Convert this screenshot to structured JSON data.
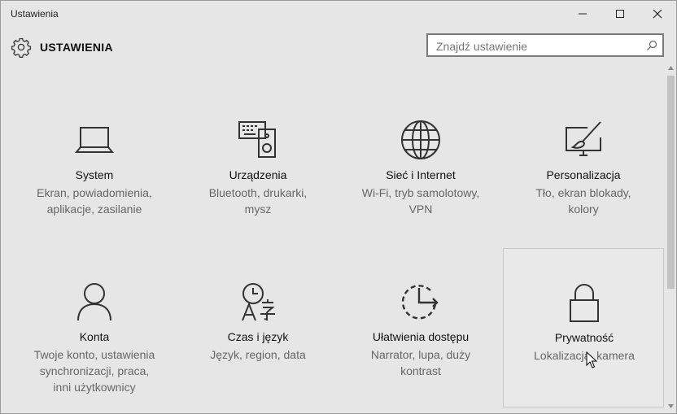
{
  "window": {
    "title": "Ustawienia"
  },
  "header": {
    "app_title": "USTAWIENIA"
  },
  "search": {
    "placeholder": "Znajdź ustawienie"
  },
  "tiles": [
    {
      "name": "System",
      "desc1": "Ekran, powiadomienia,",
      "desc2": "aplikacje, zasilanie",
      "desc3": "",
      "icon": "laptop-icon"
    },
    {
      "name": "Urządzenia",
      "desc1": "Bluetooth, drukarki,",
      "desc2": "mysz",
      "desc3": "",
      "icon": "devices-icon"
    },
    {
      "name": "Sieć i Internet",
      "desc1": "Wi-Fi, tryb samolotowy,",
      "desc2": "VPN",
      "desc3": "",
      "icon": "globe-icon"
    },
    {
      "name": "Personalizacja",
      "desc1": "Tło, ekran blokady,",
      "desc2": "kolory",
      "desc3": "",
      "icon": "paint-icon"
    },
    {
      "name": "Konta",
      "desc1": "Twoje konto, ustawienia",
      "desc2": "synchronizacji, praca,",
      "desc3": "inni użytkownicy",
      "icon": "person-icon"
    },
    {
      "name": "Czas i język",
      "desc1": "Język, region, data",
      "desc2": "",
      "desc3": "",
      "icon": "time-language-icon"
    },
    {
      "name": "Ułatwienia dostępu",
      "desc1": "Narrator, lupa, duży",
      "desc2": "kontrast",
      "desc3": "",
      "icon": "accessibility-icon"
    },
    {
      "name": "Prywatność",
      "desc1": "Lokalizacja, kamera",
      "desc2": "",
      "desc3": "",
      "icon": "lock-icon"
    }
  ],
  "colors": {
    "background": "#e6e6e6",
    "text": "#111111",
    "subtext": "#666666",
    "icon": "#333333"
  }
}
